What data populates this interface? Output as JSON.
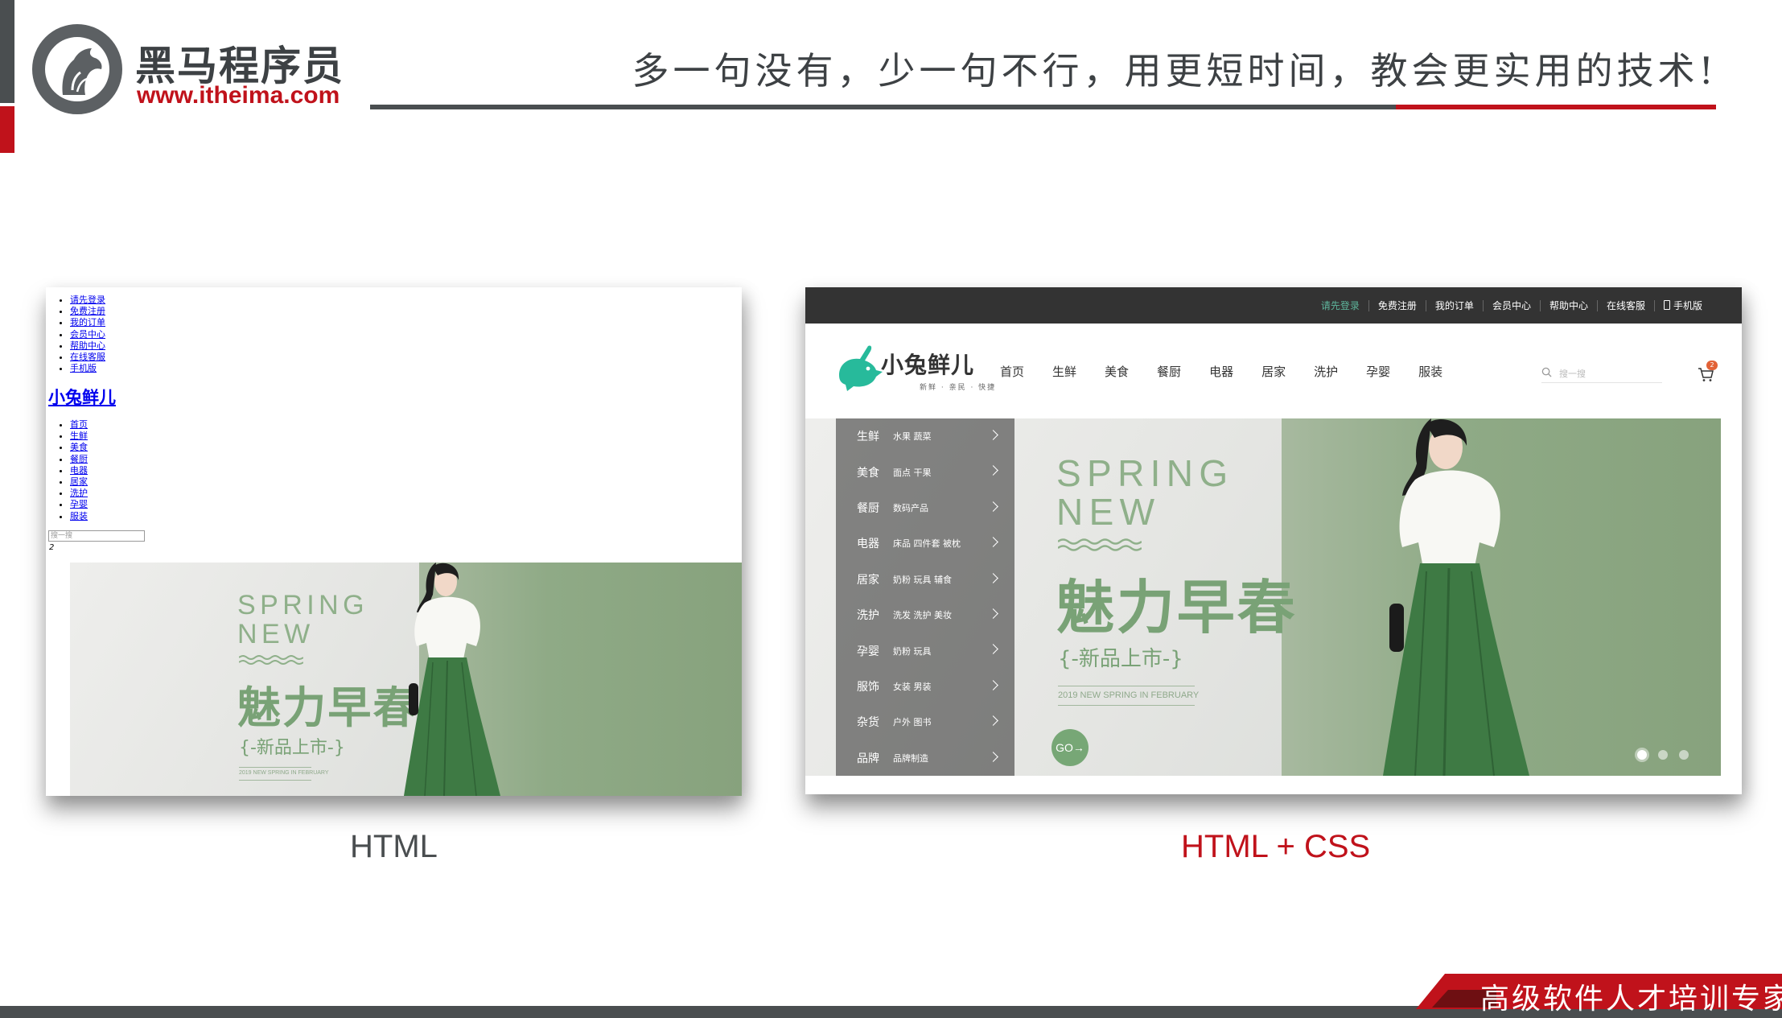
{
  "slide": {
    "brand_cn": "黑马程序员",
    "brand_url": "www.itheima.com",
    "slogan": "多一句没有，少一句不行，用更短时间，教会更实用的技术!",
    "footer_slogan": "高级软件人才培训专家",
    "caption_left": "HTML",
    "caption_right": "HTML + CSS",
    "colors": {
      "brand_red": "#c0121b",
      "brand_gray": "#4a4e50",
      "site_green": "#5eb69c"
    }
  },
  "site": {
    "top_links": [
      "请先登录",
      "免费注册",
      "我的订单",
      "会员中心",
      "帮助中心",
      "在线客服",
      "手机版"
    ],
    "logo_text": "小兔鲜儿",
    "logo_sub": "新鲜 · 亲民 · 快捷",
    "nav": [
      "首页",
      "生鲜",
      "美食",
      "餐厨",
      "电器",
      "居家",
      "洗护",
      "孕婴",
      "服装"
    ],
    "search_placeholder": "搜一搜",
    "cart_count": "2",
    "raw_nav": [
      "首页",
      "生鲜",
      "美食",
      "餐厨",
      "电器",
      "居家",
      "洗护",
      "孕婴",
      "服装"
    ],
    "categories": [
      {
        "main": "生鲜",
        "sub": "水果 蔬菜"
      },
      {
        "main": "美食",
        "sub": "面点 干果"
      },
      {
        "main": "餐厨",
        "sub": "数码产品"
      },
      {
        "main": "电器",
        "sub": "床品 四件套 被枕"
      },
      {
        "main": "居家",
        "sub": "奶粉 玩具 辅食"
      },
      {
        "main": "洗护",
        "sub": "洗发 洗护 美妆"
      },
      {
        "main": "孕婴",
        "sub": "奶粉 玩具"
      },
      {
        "main": "服饰",
        "sub": "女装 男装"
      },
      {
        "main": "杂货",
        "sub": "户外 图书"
      },
      {
        "main": "品牌",
        "sub": "品牌制造"
      }
    ],
    "banner": {
      "spring": "SPRING",
      "new": "NEW",
      "headline": "魅力早春",
      "sub": "{-新品上市-}",
      "tiny": "2019 NEW SPRING IN FEBRUARY",
      "go": "GO→"
    },
    "carousel_slides": 3,
    "carousel_active": 1
  }
}
